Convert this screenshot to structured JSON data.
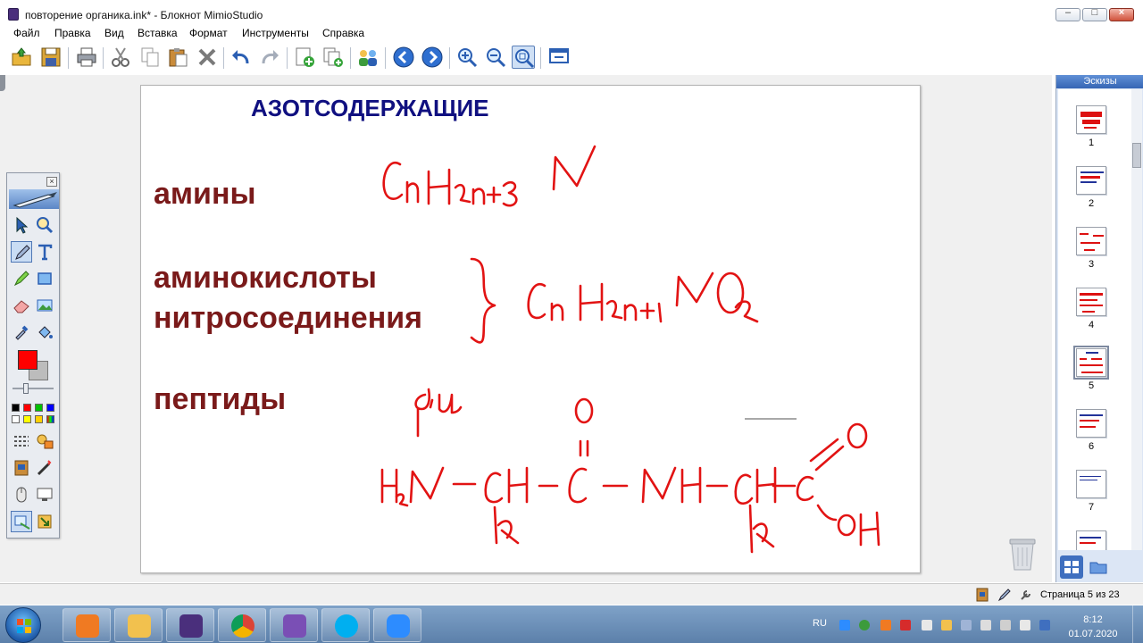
{
  "window": {
    "title": "повторение органика.ink* - Блокнот MimioStudio",
    "minimize_label": "–",
    "maximize_label": "□",
    "close_label": "×"
  },
  "menu": [
    "Файл",
    "Правка",
    "Вид",
    "Вставка",
    "Формат",
    "Инструменты",
    "Справка"
  ],
  "page": {
    "heading": "АЗОТСОДЕРЖАЩИЕ",
    "labels": [
      "амины",
      "аминокислоты",
      "нитросоединения",
      "пептиды"
    ]
  },
  "thumbnails": {
    "header": "Эскизы",
    "pages": [
      "1",
      "2",
      "3",
      "4",
      "5",
      "6",
      "7"
    ],
    "selected": "5"
  },
  "status": {
    "page_indicator": "Страница 5 из 23"
  },
  "taskbar": {
    "language": "RU",
    "time": "8:12",
    "date": "01.07.2020"
  },
  "colors": {
    "ink": "#e21313",
    "heading": "#101080",
    "label": "#7a1a1a"
  }
}
